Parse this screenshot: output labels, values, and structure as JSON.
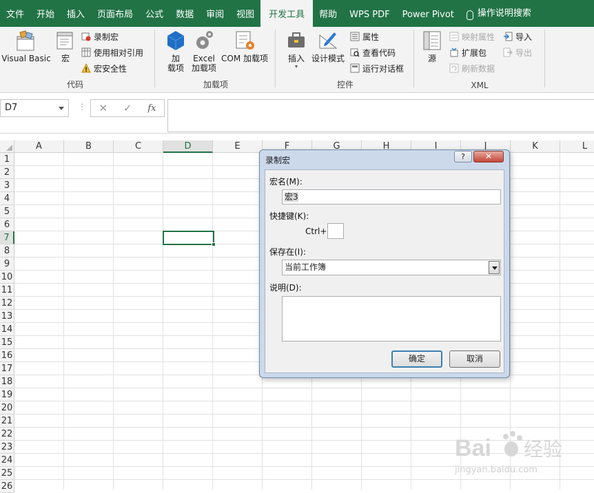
{
  "ribbon_tabs": [
    "文件",
    "开始",
    "插入",
    "页面布局",
    "公式",
    "数据",
    "审阅",
    "视图",
    "开发工具",
    "帮助",
    "WPS PDF",
    "Power Pivot",
    "操作说明搜索"
  ],
  "active_tab": "开发工具",
  "groups": {
    "code": {
      "label": "代码",
      "visual_basic": "Visual Basic",
      "macro": "宏",
      "record_macro": "录制宏",
      "relative_ref": "使用相对引用",
      "macro_security": "宏安全性"
    },
    "addins": {
      "label": "加载项",
      "addins_btn": "加\n载项",
      "excel_addins": "Excel\n加载项",
      "com_addins": "COM 加载项"
    },
    "controls": {
      "label": "控件",
      "insert": "插入",
      "design_mode": "设计模式",
      "properties": "属性",
      "view_code": "查看代码",
      "run_dialog": "运行对话框"
    },
    "xml": {
      "label": "XML",
      "source": "源",
      "map_props": "映射属性",
      "expansion": "扩展包",
      "refresh": "刷新数据",
      "import": "导入",
      "export": "导出"
    }
  },
  "namebox": "D7",
  "columns": [
    "A",
    "B",
    "C",
    "D",
    "E",
    "F",
    "G",
    "H",
    "I",
    "J",
    "K",
    "L"
  ],
  "selected_column": "D",
  "rows": [
    "1",
    "2",
    "3",
    "4",
    "5",
    "6",
    "7",
    "8",
    "9",
    "10",
    "11",
    "12",
    "13",
    "14",
    "15",
    "16",
    "17",
    "18",
    "19",
    "20",
    "21",
    "22",
    "23",
    "24",
    "25",
    "26"
  ],
  "selected_row": "7",
  "dialog": {
    "title": "录制宏",
    "help": "?",
    "close": "✕",
    "macro_name_label": "宏名(M):",
    "macro_name_value": "宏3",
    "shortcut_label": "快捷键(K):",
    "ctrl_prefix": "Ctrl+",
    "shortcut_value": "",
    "store_in_label": "保存在(I):",
    "store_in_value": "当前工作簿",
    "description_label": "说明(D):",
    "description_value": "",
    "ok": "确定",
    "cancel": "取消"
  },
  "watermark": {
    "brand": "Bai",
    "brand2": "经验",
    "url": "jingyan.baidu.com"
  },
  "colors": {
    "ribbon_green": "#217346",
    "dialog_frame": "#cbd9ea",
    "close_red": "#c5463a"
  }
}
